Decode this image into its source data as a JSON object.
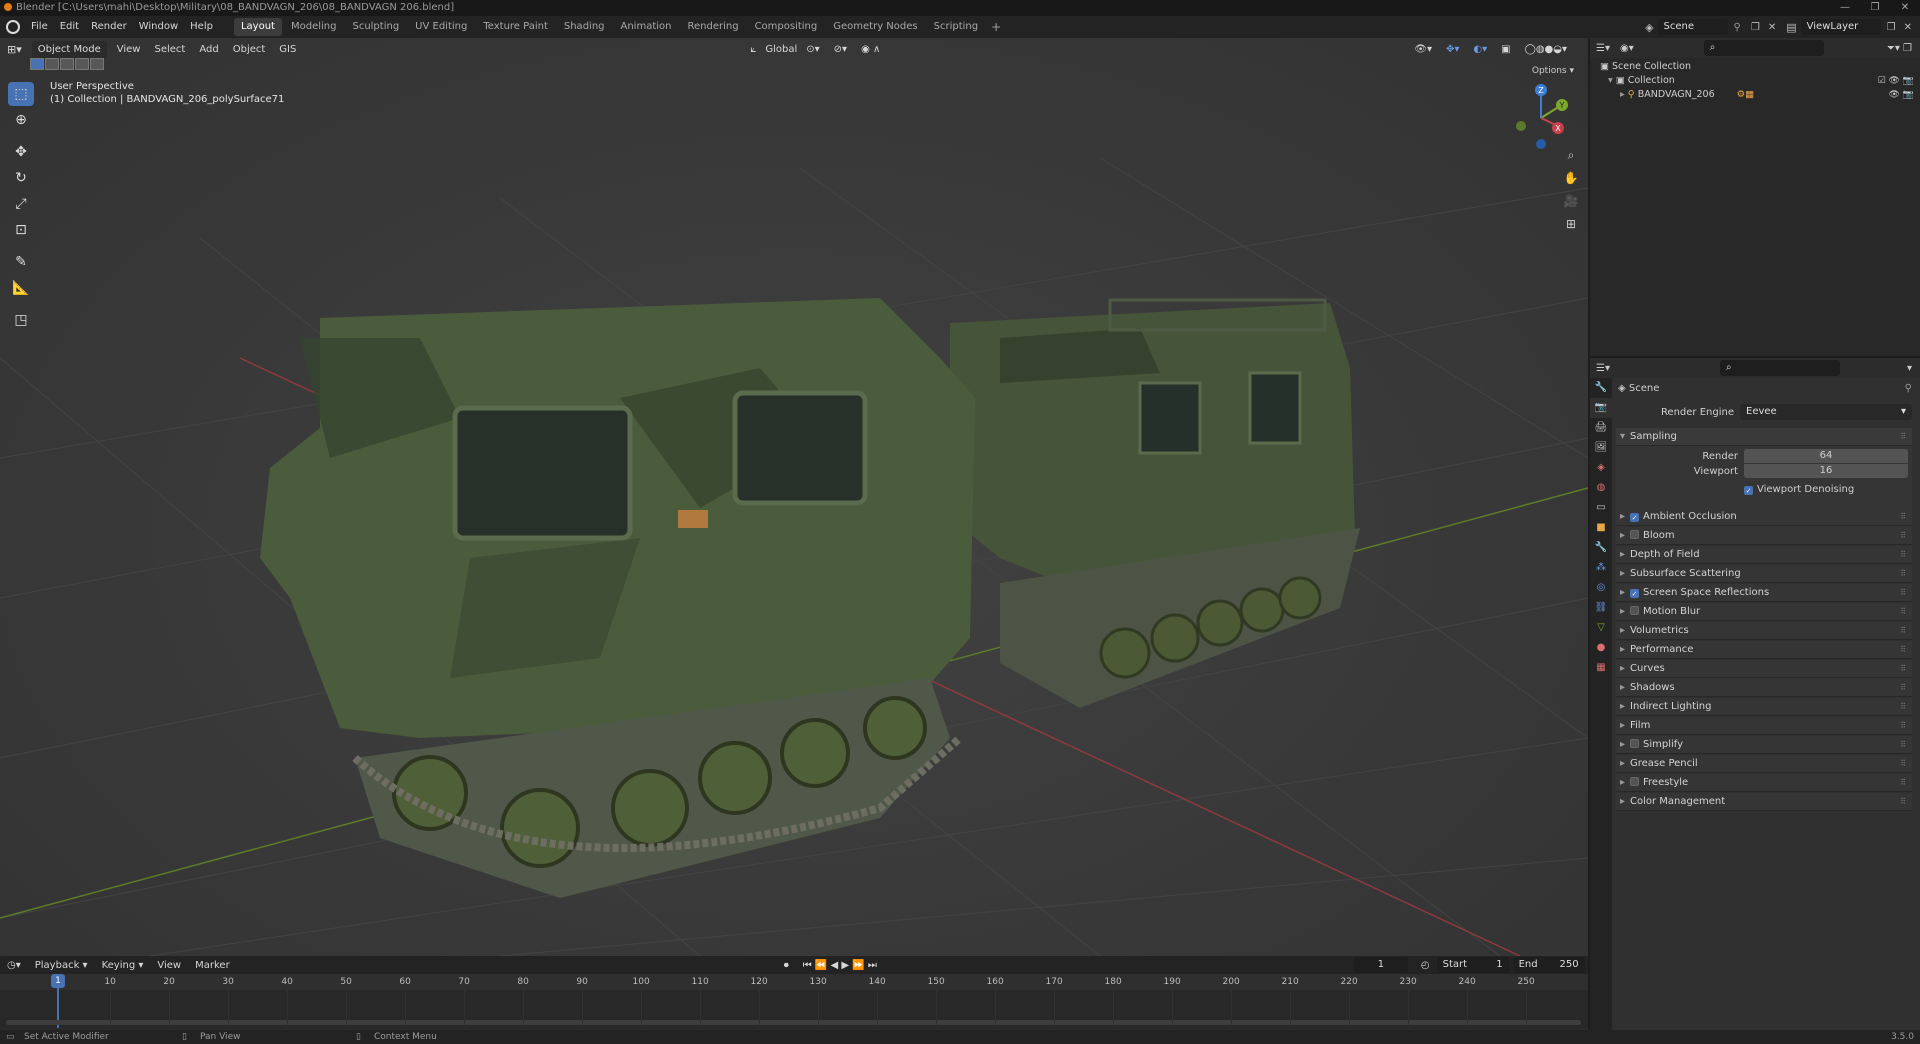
{
  "window": {
    "title": "Blender [C:\\Users\\mahi\\Desktop\\Military\\08_BANDVAGN_206\\08_BANDVAGN 206.blend]",
    "controls": [
      "—",
      "❐",
      "✕"
    ]
  },
  "menu": [
    "File",
    "Edit",
    "Render",
    "Window",
    "Help"
  ],
  "workspaces": [
    "Layout",
    "Modeling",
    "Sculpting",
    "UV Editing",
    "Texture Paint",
    "Shading",
    "Animation",
    "Rendering",
    "Compositing",
    "Geometry Nodes",
    "Scripting"
  ],
  "active_workspace": "Layout",
  "scene_selector": "Scene",
  "view_layer": "ViewLayer",
  "viewport": {
    "mode": "Object Mode",
    "menus": [
      "View",
      "Select",
      "Add",
      "Object",
      "GIS"
    ],
    "transform_orientation": "Global",
    "perspective_label": "User Perspective",
    "collection_label": "(1) Collection | BANDVAGN_206_polySurface71",
    "options_label": "Options",
    "gizmo_axes": [
      "X",
      "Y",
      "Z"
    ],
    "colors": {
      "x_axis": "#c8404c",
      "y_axis": "#7da82e",
      "z_axis": "#3d7fd6",
      "accent": "#4772b3"
    }
  },
  "tools": [
    "select-box-icon",
    "cursor-icon",
    "move-icon",
    "rotate-icon",
    "scale-icon",
    "transform-icon",
    "annotate-icon",
    "measure-icon",
    "add-cube-icon"
  ],
  "nav_buttons": [
    "zoom-icon",
    "pan-hand-icon",
    "camera-icon",
    "grid-ortho-icon"
  ],
  "outliner": {
    "items": [
      {
        "label": "Scene Collection",
        "indent": 0
      },
      {
        "label": "Collection",
        "indent": 1
      },
      {
        "label": "BANDVAGN_206",
        "indent": 2
      }
    ]
  },
  "properties": {
    "context": "Scene",
    "render_engine_label": "Render Engine",
    "render_engine": "Eevee",
    "sampling": {
      "title": "Sampling",
      "render_label": "Render",
      "render_value": "64",
      "viewport_label": "Viewport",
      "viewport_value": "16",
      "denoise_label": "Viewport Denoising"
    },
    "panels": [
      {
        "label": "Ambient Occlusion",
        "checkbox": true,
        "checked": true
      },
      {
        "label": "Bloom",
        "checkbox": true,
        "checked": false
      },
      {
        "label": "Depth of Field",
        "checkbox": false,
        "checked": false
      },
      {
        "label": "Subsurface Scattering",
        "checkbox": false,
        "checked": false
      },
      {
        "label": "Screen Space Reflections",
        "checkbox": true,
        "checked": true
      },
      {
        "label": "Motion Blur",
        "checkbox": true,
        "checked": false
      },
      {
        "label": "Volumetrics",
        "checkbox": false,
        "checked": false
      },
      {
        "label": "Performance",
        "checkbox": false,
        "checked": false
      },
      {
        "label": "Curves",
        "checkbox": false,
        "checked": false
      },
      {
        "label": "Shadows",
        "checkbox": false,
        "checked": false
      },
      {
        "label": "Indirect Lighting",
        "checkbox": false,
        "checked": false
      },
      {
        "label": "Film",
        "checkbox": false,
        "checked": false
      },
      {
        "label": "Simplify",
        "checkbox": true,
        "checked": false
      },
      {
        "label": "Grease Pencil",
        "checkbox": false,
        "checked": false
      },
      {
        "label": "Freestyle",
        "checkbox": true,
        "checked": false
      },
      {
        "label": "Color Management",
        "checkbox": false,
        "checked": false
      }
    ]
  },
  "timeline": {
    "menus": [
      "Playback",
      "Keying",
      "View",
      "Marker"
    ],
    "current_frame": "1",
    "start_label": "Start",
    "start": "1",
    "end_label": "End",
    "end": "250",
    "ticks": [
      "10",
      "20",
      "30",
      "40",
      "50",
      "60",
      "70",
      "80",
      "90",
      "100",
      "110",
      "120",
      "130",
      "140",
      "150",
      "160",
      "170",
      "180",
      "190",
      "200",
      "210",
      "220",
      "230",
      "240",
      "250"
    ]
  },
  "statusbar": {
    "left": "Set Active Modifier",
    "middle": "Pan View",
    "right": "Context Menu",
    "version": "3.5.0"
  }
}
